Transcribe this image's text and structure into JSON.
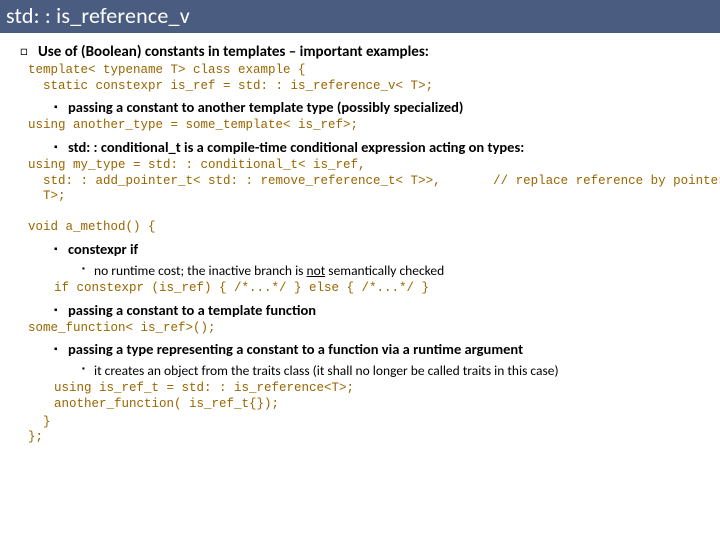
{
  "title": "std: : is_reference_v",
  "bul1": "Use of (Boolean) constants in templates – important examples:",
  "code1": "template< typename T> class example {\n  static constexpr is_ref = std: : is_reference_v< T>;",
  "bul2_1": "passing a constant to another template type (possibly specialized)",
  "code2": "using another_type = some_template< is_ref>;",
  "bul2_2": "std: : conditional_t is a compile-time conditional expression acting on types:",
  "code3": "using my_type = std: : conditional_t< is_ref,\n  std: : add_pointer_t< std: : remove_reference_t< T>>,       // replace reference by pointer\n  T>;\n\nvoid a_method() {",
  "bul2_3": "constexpr if",
  "bul3_1a": "no runtime cost; the inactive branch is ",
  "bul3_1b": "not",
  "bul3_1c": " semantically checked",
  "code4": "if constexpr (is_ref) { /*...*/ } else { /*...*/ }",
  "bul2_4": "passing a constant to a template function",
  "code5": "some_function< is_ref>();",
  "bul2_5": "passing a type representing a constant to a function via a runtime argument",
  "bul3_2": "it creates an object from the traits class (it shall no longer be called traits in this case)",
  "code6": "using is_ref_t = std: : is_reference<T>;\nanother_function( is_ref_t{});",
  "code7": "  }\n};"
}
